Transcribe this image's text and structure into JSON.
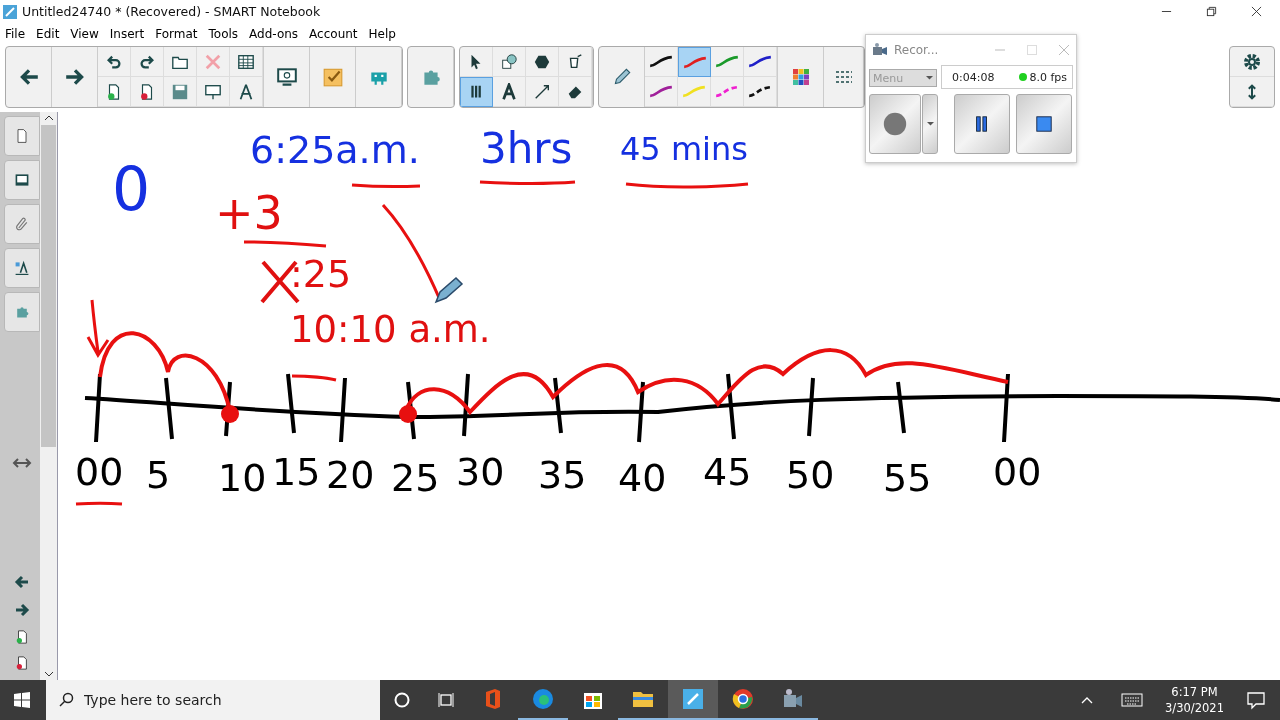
{
  "window": {
    "title": "Untitled24740 * (Recovered) - SMART Notebook"
  },
  "menu": [
    "File",
    "Edit",
    "View",
    "Insert",
    "Format",
    "Tools",
    "Add-ons",
    "Account",
    "Help"
  ],
  "tools": [
    {
      "selected": false
    },
    {
      "selected": false
    },
    {
      "selected": false
    },
    {
      "selected": false
    },
    {
      "selected": true
    },
    {
      "selected": false
    },
    {
      "selected": false
    },
    {
      "selected": false
    }
  ],
  "pens": [
    {
      "color": "#111111",
      "kind": "solid",
      "selected": false
    },
    {
      "color": "#e02020",
      "kind": "solid",
      "selected": true
    },
    {
      "color": "#1a9a2a",
      "kind": "solid",
      "selected": false
    },
    {
      "color": "#2020c8",
      "kind": "solid",
      "selected": false
    },
    {
      "color": "#a0209a",
      "kind": "solid",
      "selected": false
    },
    {
      "color": "#f0e020",
      "kind": "solid",
      "selected": false
    },
    {
      "color": "#f020d0",
      "kind": "dashed",
      "selected": false
    },
    {
      "color": "#111111",
      "kind": "dashed",
      "selected": false
    }
  ],
  "recorder": {
    "title": "Recor...",
    "menu": "Menu",
    "time": "0:04:08",
    "fps": "8.0 fps",
    "active": true
  },
  "handwriting": [
    {
      "text": "6:25a.m.",
      "color": "#1530e0"
    },
    {
      "text": "3hrs",
      "color": "#1530e0"
    },
    {
      "text": "45 mins",
      "color": "#1530e0"
    },
    {
      "text": "0",
      "color": "#1530e0"
    },
    {
      "text": "+3",
      "color": "#e01010"
    },
    {
      "text": ":25",
      "color": "#e01010"
    },
    {
      "text": "10:10 a.m.",
      "color": "#e01010"
    }
  ],
  "number_line": [
    "00",
    "5",
    "10",
    "15",
    "20",
    "25",
    "30",
    "35",
    "40",
    "45",
    "50",
    "55",
    "00"
  ],
  "taskbar": {
    "search": {
      "placeholder": "Type here to search"
    },
    "apps": [
      {
        "running": false,
        "active": false
      },
      {
        "running": true,
        "active": false
      },
      {
        "running": false,
        "active": false
      },
      {
        "running": true,
        "active": false
      },
      {
        "running": true,
        "active": true
      },
      {
        "running": true,
        "active": false
      },
      {
        "running": true,
        "active": false
      }
    ],
    "time": "6:17 PM",
    "date": "3/30/2021"
  }
}
